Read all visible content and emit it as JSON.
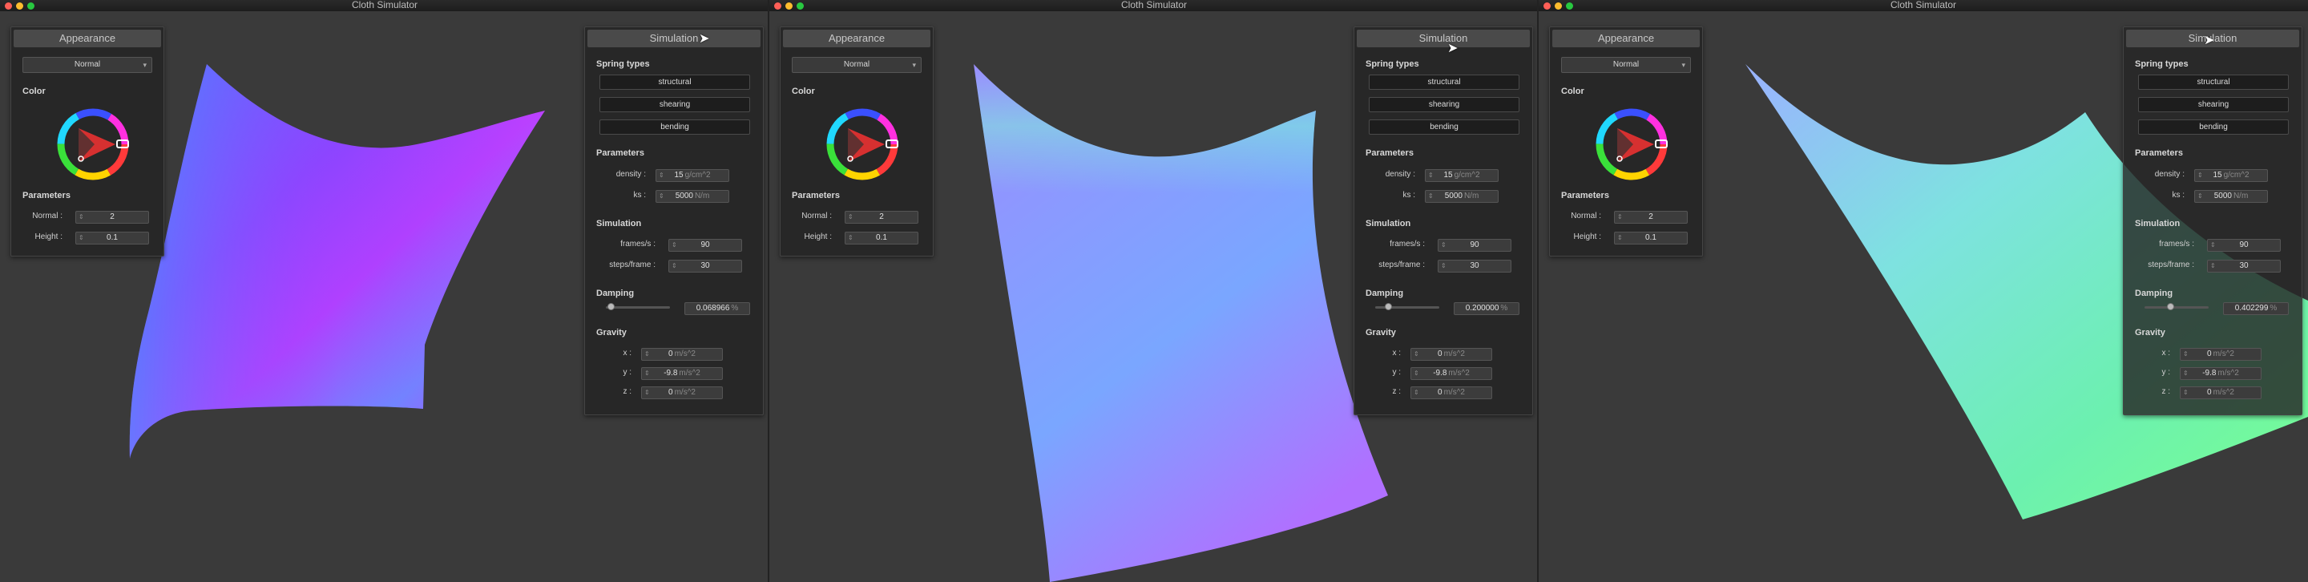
{
  "windows": [
    {
      "title": "Cloth Simulator",
      "appearance": {
        "header": "Appearance",
        "shading_mode": "Normal",
        "color_label": "Color",
        "params_label": "Parameters",
        "normal_label": "Normal :",
        "normal_value": "2",
        "height_label": "Height :",
        "height_value": "0.1"
      },
      "simulation": {
        "header": "Simulation",
        "spring_types_label": "Spring types",
        "spring_types": [
          "structural",
          "shearing",
          "bending"
        ],
        "parameters_label": "Parameters",
        "density_label": "density :",
        "density_value": "15",
        "density_unit": "g/cm^2",
        "ks_label": "ks :",
        "ks_value": "5000",
        "ks_unit": "N/m",
        "sim_label": "Simulation",
        "fps_label": "frames/s :",
        "fps_value": "90",
        "steps_label": "steps/frame :",
        "steps_value": "30",
        "damping_label": "Damping",
        "damping_value": "0.068966",
        "damping_unit": "%",
        "damping_fraction": 0.07,
        "gravity_label": "Gravity",
        "gx_label": "x :",
        "gx_value": "0",
        "gy_label": "y :",
        "gy_value": "-9.8",
        "gz_label": "z :",
        "gz_value": "0",
        "gravity_unit": "m/s^2"
      }
    },
    {
      "title": "Cloth Simulator",
      "appearance": {
        "header": "Appearance",
        "shading_mode": "Normal",
        "color_label": "Color",
        "params_label": "Parameters",
        "normal_label": "Normal :",
        "normal_value": "2",
        "height_label": "Height :",
        "height_value": "0.1"
      },
      "simulation": {
        "header": "Simulation",
        "spring_types_label": "Spring types",
        "spring_types": [
          "structural",
          "shearing",
          "bending"
        ],
        "parameters_label": "Parameters",
        "density_label": "density :",
        "density_value": "15",
        "density_unit": "g/cm^2",
        "ks_label": "ks :",
        "ks_value": "5000",
        "ks_unit": "N/m",
        "sim_label": "Simulation",
        "fps_label": "frames/s :",
        "fps_value": "90",
        "steps_label": "steps/frame :",
        "steps_value": "30",
        "damping_label": "Damping",
        "damping_value": "0.200000",
        "damping_unit": "%",
        "damping_fraction": 0.2,
        "gravity_label": "Gravity",
        "gx_label": "x :",
        "gx_value": "0",
        "gy_label": "y :",
        "gy_value": "-9.8",
        "gz_label": "z :",
        "gz_value": "0",
        "gravity_unit": "m/s^2"
      }
    },
    {
      "title": "Cloth Simulator",
      "appearance": {
        "header": "Appearance",
        "shading_mode": "Normal",
        "color_label": "Color",
        "params_label": "Parameters",
        "normal_label": "Normal :",
        "normal_value": "2",
        "height_label": "Height :",
        "height_value": "0.1"
      },
      "simulation": {
        "header": "Simulation",
        "spring_types_label": "Spring types",
        "spring_types": [
          "structural",
          "shearing",
          "bending"
        ],
        "parameters_label": "Parameters",
        "density_label": "density :",
        "density_value": "15",
        "density_unit": "g/cm^2",
        "ks_label": "ks :",
        "ks_value": "5000",
        "ks_unit": "N/m",
        "sim_label": "Simulation",
        "fps_label": "frames/s :",
        "fps_value": "90",
        "steps_label": "steps/frame :",
        "steps_value": "30",
        "damping_label": "Damping",
        "damping_value": "0.402299",
        "damping_unit": "%",
        "damping_fraction": 0.4,
        "gravity_label": "Gravity",
        "gx_label": "x :",
        "gx_value": "0",
        "gy_label": "y :",
        "gy_value": "-9.8",
        "gz_label": "z :",
        "gz_value": "0",
        "gravity_unit": "m/s^2"
      }
    }
  ],
  "colors": {
    "window_bg": "#3a3a3a",
    "panel_bg": "#262626",
    "cloth_purple": "#8a4dff",
    "cloth_blue": "#7f9bff",
    "cloth_green": "#6dffb0"
  }
}
